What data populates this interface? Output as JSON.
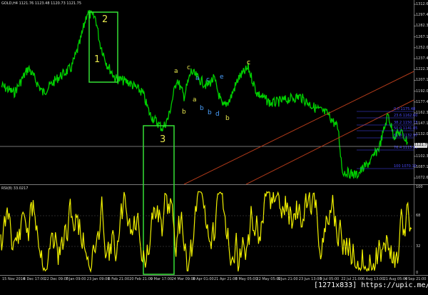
{
  "header": {
    "symbol_line": "GOLD,H4  1121.76  1123.48  1120.73  1121.75"
  },
  "price_axis": {
    "ticks": [
      "1312.60",
      "1297.45",
      "1282.30",
      "1267.15",
      "1252.00",
      "1237.45",
      "1222.30",
      "1207.15",
      "1192.00",
      "1177.45",
      "1162.30",
      "1147.15",
      "1132.00",
      "1117.45",
      "1102.30",
      "1087.15",
      "1072.60"
    ],
    "current_price": "1121.75"
  },
  "rsi": {
    "title": "RSI(8) 33.0217",
    "levels": [
      "100",
      "68",
      "32",
      "0"
    ]
  },
  "time_axis": {
    "labels": [
      "15 Nov 2016",
      "4 Dec 17:00",
      "22 Dec 09:00",
      "7 Jan 09:00",
      "23 Jan 09:00",
      "6 Feb 21:00",
      "20 Feb 21:00",
      "9 Mar 17:00",
      "24 Mar 09:00",
      "8 Apr 01:00",
      "21 Apr 21:00",
      "8 May 05:00",
      "22 May 05:00",
      "6 Jun 21:00",
      "23 Jun 13:00",
      "9 Jul 05:00",
      "22 Jul 21:00",
      "6 Aug 13:00",
      "21 Aug 05:00",
      "4 Sep 21:00"
    ]
  },
  "wave_labels": {
    "big": [
      "2",
      "1",
      "3"
    ],
    "small": [
      "a",
      "c",
      "b",
      "a",
      "b",
      "a",
      "c",
      "b",
      "c",
      "d",
      "e",
      "b",
      "c"
    ]
  },
  "fib_levels": [
    "0.0 1175.48",
    "23.6 1162.60",
    "38.2 1150.73",
    "50.0 1141.85",
    "61.8 1132.97",
    "76.4 1115.61",
    "100 1070.10"
  ],
  "watermark": "[1271x833] https://upic.me/",
  "colors": {
    "background": "#000000",
    "price_line": "#00d000",
    "rsi_line": "#f0f000",
    "box": "#35e035",
    "trend_lines": "#b03a1a",
    "fib": "#4a4aff",
    "wave_yellow": "#e6e64d",
    "wave_blue": "#4aa0ff"
  }
}
